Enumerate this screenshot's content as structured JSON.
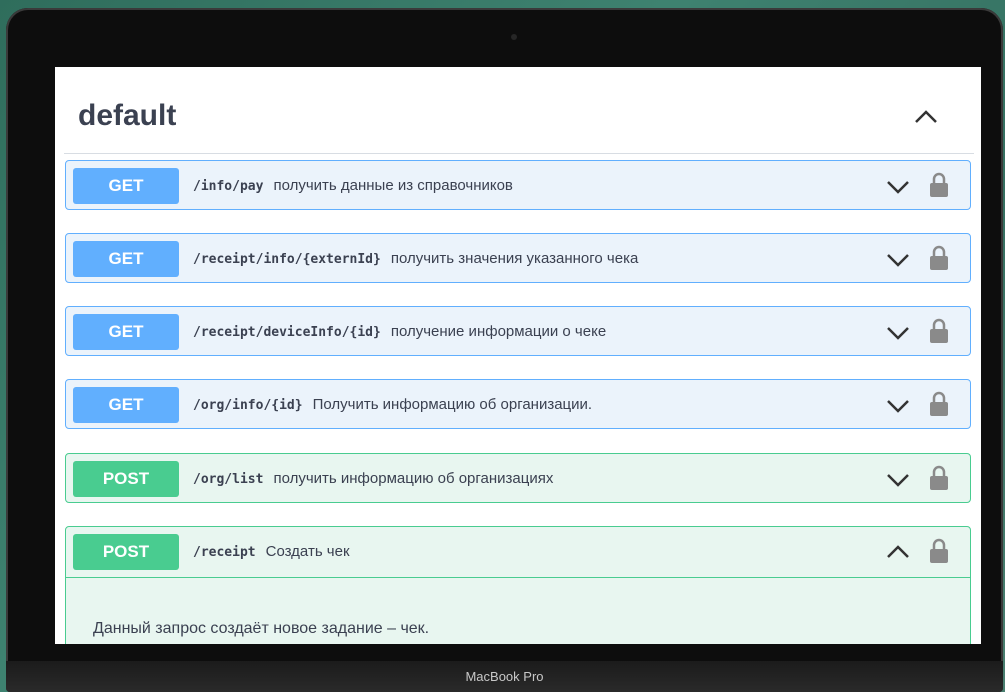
{
  "section": {
    "title": "default"
  },
  "operations": [
    {
      "method": "GET",
      "path": "/info/pay",
      "summary": "получить данные из справочников"
    },
    {
      "method": "GET",
      "path": "/receipt/info/{externId}",
      "summary": "получить значения указанного чека"
    },
    {
      "method": "GET",
      "path": "/receipt/deviceInfo/{id}",
      "summary": "получение информации о чеке"
    },
    {
      "method": "GET",
      "path": "/org/info/{id}",
      "summary": "Получить информацию об организации."
    },
    {
      "method": "POST",
      "path": "/org/list",
      "summary": "получить информацию об организациях"
    },
    {
      "method": "POST",
      "path": "/receipt",
      "summary": "Создать чек",
      "expanded": true,
      "description": "Данный запрос создаёт новое задание – чек."
    }
  ],
  "device": {
    "brand": "MacBook Pro"
  },
  "colors": {
    "get": "#61affe",
    "post": "#49cc90",
    "text": "#3b4151"
  },
  "icons": {
    "collapse": "chevron-up-icon",
    "expand": "chevron-down-icon",
    "lock": "lock-icon"
  }
}
